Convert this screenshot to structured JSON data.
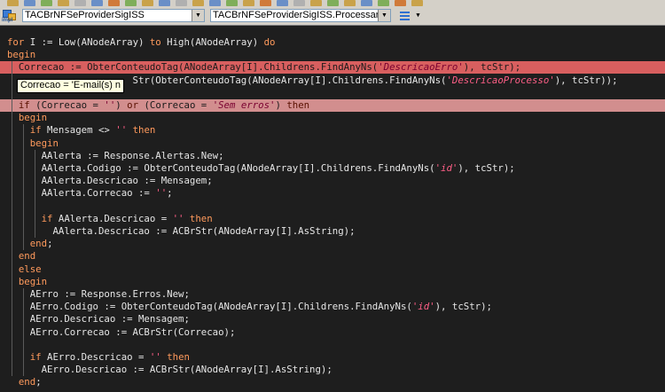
{
  "navbar": {
    "class_combo": "TACBrNFSeProviderSigISS",
    "method_combo": "TACBrNFSeProviderSigISS.ProcessarMensagen",
    "unit_icon_label": "impl"
  },
  "tooltip": {
    "text": "Correcao = 'E-mail(s) n"
  },
  "colors": {
    "editor_bg": "#1e1e1e",
    "keyword": "#ff9a5c",
    "string": "#ff5f87",
    "error_line_strong": "#d85f5f",
    "error_line_light": "#d28e8e"
  },
  "code": {
    "lines": [
      {
        "style": "normal",
        "tokens": [
          {
            "t": "kw",
            "v": "for"
          },
          {
            "t": "plain",
            "v": " I := Low(ANodeArray) "
          },
          {
            "t": "kw",
            "v": "to"
          },
          {
            "t": "plain",
            "v": " High(ANodeArray) "
          },
          {
            "t": "kw",
            "v": "do"
          }
        ]
      },
      {
        "style": "normal",
        "tokens": [
          {
            "t": "kw",
            "v": "begin"
          }
        ]
      },
      {
        "style": "err-strong",
        "tokens": [
          {
            "t": "plain",
            "v": "  Correcao := ObterConteudoTag(ANodeArray[I].Childrens.FindAnyNs("
          },
          {
            "t": "str",
            "v": "'DescricaoErro'"
          },
          {
            "t": "plain",
            "v": "), tcStr);"
          }
        ]
      },
      {
        "style": "normal",
        "tokens": [
          {
            "t": "plain",
            "v": "                      Str(ObterConteudoTag(ANodeArray[I].Childrens.FindAnyNs("
          },
          {
            "t": "str",
            "v": "'DescricaoProcesso'"
          },
          {
            "t": "plain",
            "v": "), tcStr));"
          }
        ]
      },
      {
        "style": "normal",
        "tokens": []
      },
      {
        "style": "err-light",
        "tokens": [
          {
            "t": "plain",
            "v": "  "
          },
          {
            "t": "kw",
            "v": "if"
          },
          {
            "t": "plain",
            "v": " (Correcao = "
          },
          {
            "t": "str",
            "v": "''"
          },
          {
            "t": "plain",
            "v": ") "
          },
          {
            "t": "kw",
            "v": "or"
          },
          {
            "t": "plain",
            "v": " (Correcao = "
          },
          {
            "t": "str",
            "v": "'Sem erros'"
          },
          {
            "t": "plain",
            "v": ") "
          },
          {
            "t": "kw",
            "v": "then"
          }
        ]
      },
      {
        "style": "normal",
        "tokens": [
          {
            "t": "plain",
            "v": "  "
          },
          {
            "t": "kw",
            "v": "begin"
          }
        ]
      },
      {
        "style": "normal",
        "tokens": [
          {
            "t": "plain",
            "v": "    "
          },
          {
            "t": "kw",
            "v": "if"
          },
          {
            "t": "plain",
            "v": " Mensagem <> "
          },
          {
            "t": "str",
            "v": "''"
          },
          {
            "t": "plain",
            "v": " "
          },
          {
            "t": "kw",
            "v": "then"
          }
        ]
      },
      {
        "style": "normal",
        "tokens": [
          {
            "t": "plain",
            "v": "    "
          },
          {
            "t": "kw",
            "v": "begin"
          }
        ]
      },
      {
        "style": "normal",
        "tokens": [
          {
            "t": "plain",
            "v": "      AAlerta := Response.Alertas.New;"
          }
        ]
      },
      {
        "style": "normal",
        "tokens": [
          {
            "t": "plain",
            "v": "      AAlerta.Codigo := ObterConteudoTag(ANodeArray[I].Childrens.FindAnyNs("
          },
          {
            "t": "str",
            "v": "'id'"
          },
          {
            "t": "plain",
            "v": "), tcStr);"
          }
        ]
      },
      {
        "style": "normal",
        "tokens": [
          {
            "t": "plain",
            "v": "      AAlerta.Descricao := Mensagem;"
          }
        ]
      },
      {
        "style": "normal",
        "tokens": [
          {
            "t": "plain",
            "v": "      AAlerta.Correcao := "
          },
          {
            "t": "str",
            "v": "''"
          },
          {
            "t": "plain",
            "v": ";"
          }
        ]
      },
      {
        "style": "normal",
        "tokens": []
      },
      {
        "style": "normal",
        "tokens": [
          {
            "t": "plain",
            "v": "      "
          },
          {
            "t": "kw",
            "v": "if"
          },
          {
            "t": "plain",
            "v": " AAlerta.Descricao = "
          },
          {
            "t": "str",
            "v": "''"
          },
          {
            "t": "plain",
            "v": " "
          },
          {
            "t": "kw",
            "v": "then"
          }
        ]
      },
      {
        "style": "normal",
        "tokens": [
          {
            "t": "plain",
            "v": "        AAlerta.Descricao := ACBrStr(ANodeArray[I].AsString);"
          }
        ]
      },
      {
        "style": "normal",
        "tokens": [
          {
            "t": "plain",
            "v": "    "
          },
          {
            "t": "kw",
            "v": "end"
          },
          {
            "t": "plain",
            "v": ";"
          }
        ]
      },
      {
        "style": "normal",
        "tokens": [
          {
            "t": "plain",
            "v": "  "
          },
          {
            "t": "kw",
            "v": "end"
          }
        ]
      },
      {
        "style": "normal",
        "tokens": [
          {
            "t": "plain",
            "v": "  "
          },
          {
            "t": "kw",
            "v": "else"
          }
        ]
      },
      {
        "style": "normal",
        "tokens": [
          {
            "t": "plain",
            "v": "  "
          },
          {
            "t": "kw",
            "v": "begin"
          }
        ]
      },
      {
        "style": "normal",
        "tokens": [
          {
            "t": "plain",
            "v": "    AErro := Response.Erros.New;"
          }
        ]
      },
      {
        "style": "normal",
        "tokens": [
          {
            "t": "plain",
            "v": "    AErro.Codigo := ObterConteudoTag(ANodeArray[I].Childrens.FindAnyNs("
          },
          {
            "t": "str",
            "v": "'id'"
          },
          {
            "t": "plain",
            "v": "), tcStr);"
          }
        ]
      },
      {
        "style": "normal",
        "tokens": [
          {
            "t": "plain",
            "v": "    AErro.Descricao := Mensagem;"
          }
        ]
      },
      {
        "style": "normal",
        "tokens": [
          {
            "t": "plain",
            "v": "    AErro.Correcao := ACBrStr(Correcao);"
          }
        ]
      },
      {
        "style": "normal",
        "tokens": []
      },
      {
        "style": "normal",
        "tokens": [
          {
            "t": "plain",
            "v": "    "
          },
          {
            "t": "kw",
            "v": "if"
          },
          {
            "t": "plain",
            "v": " AErro.Descricao = "
          },
          {
            "t": "str",
            "v": "''"
          },
          {
            "t": "plain",
            "v": " "
          },
          {
            "t": "kw",
            "v": "then"
          }
        ]
      },
      {
        "style": "normal",
        "tokens": [
          {
            "t": "plain",
            "v": "      AErro.Descricao := ACBrStr(ANodeArray[I].AsString);"
          }
        ]
      },
      {
        "style": "normal",
        "tokens": [
          {
            "t": "plain",
            "v": "  "
          },
          {
            "t": "kw",
            "v": "end"
          },
          {
            "t": "plain",
            "v": ";"
          }
        ]
      }
    ]
  }
}
